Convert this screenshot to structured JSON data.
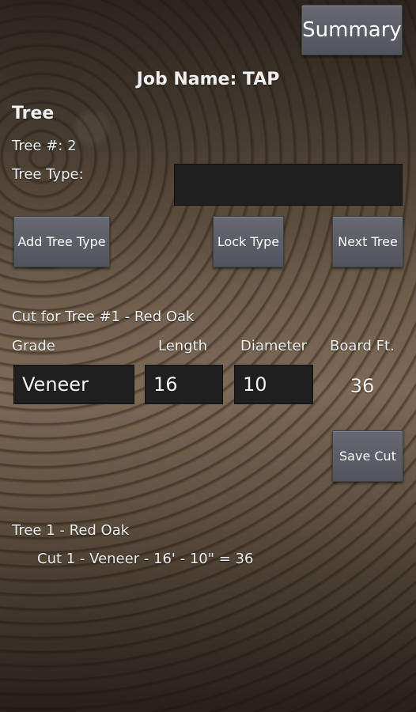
{
  "header": {
    "summary_label": "Summary",
    "job_name": "Job Name: TAP"
  },
  "tree_section": {
    "title": "Tree",
    "tree_number": "Tree #: 2",
    "tree_type_label": "Tree Type:",
    "tree_type_value": ""
  },
  "actions": {
    "add_tree_type": "Add Tree Type",
    "lock_type": "Lock Type",
    "next_tree": "Next Tree"
  },
  "cut_section": {
    "heading": "Cut for Tree #1 - Red Oak",
    "columns": [
      "Grade",
      "Length",
      "Diameter",
      "Board Ft."
    ],
    "grade_value": "Veneer",
    "length_value": "16",
    "diameter_value": "10",
    "board_ft_value": "36",
    "save_cut_label": "Save Cut"
  },
  "log": {
    "tree_line": "Tree 1 - Red Oak",
    "cut_line": "Cut 1 - Veneer - 16' - 10\" = 36"
  }
}
